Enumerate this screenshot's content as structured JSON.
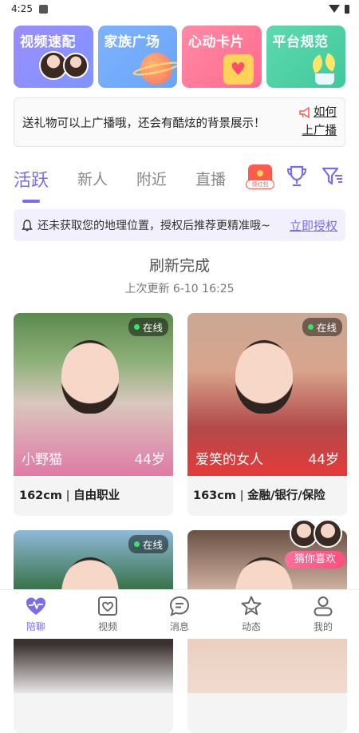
{
  "status_bar": {
    "time": "4:25"
  },
  "quick_cards": [
    {
      "title": "视频速配"
    },
    {
      "title": "家族广场"
    },
    {
      "title": "心动卡片"
    },
    {
      "title": "平台规范"
    }
  ],
  "notice": {
    "text": "送礼物可以上广播哦，还会有酷炫的背景展示！",
    "link_line1": "如何",
    "link_line2": "上广播"
  },
  "tabs": [
    {
      "label": "活跃",
      "active": true
    },
    {
      "label": "新人"
    },
    {
      "label": "附近"
    },
    {
      "label": "直播"
    }
  ],
  "redpacket_tag": "领红包",
  "location_bar": {
    "text": "还未获取您的地理位置，授权后推荐更精准哦~",
    "link": "立即授权"
  },
  "refresh": {
    "title": "刷新完成",
    "subtitle": "上次更新 6-10 16:25"
  },
  "cards": [
    {
      "online": "在线",
      "nickname": "小野猫",
      "age": "44岁",
      "height": "162cm",
      "job": "自由职业"
    },
    {
      "online": "在线",
      "nickname": "爱笑的女人",
      "age": "44岁",
      "height": "163cm",
      "job": "金融/银行/保险"
    },
    {
      "online": "在线"
    },
    {
      "online": ""
    }
  ],
  "guess_label": "猜你喜欢",
  "bottom_nav": [
    {
      "label": "陪聊",
      "icon": "heartbeat-icon",
      "active": true
    },
    {
      "label": "视频",
      "icon": "video-heart-icon"
    },
    {
      "label": "消息",
      "icon": "chat-icon"
    },
    {
      "label": "动态",
      "icon": "star-icon"
    },
    {
      "label": "我的",
      "icon": "profile-icon"
    }
  ],
  "colors": {
    "accent": "#7a6cf0",
    "online_dot": "#3ee06a",
    "red_packet": "#ff5a4e"
  }
}
